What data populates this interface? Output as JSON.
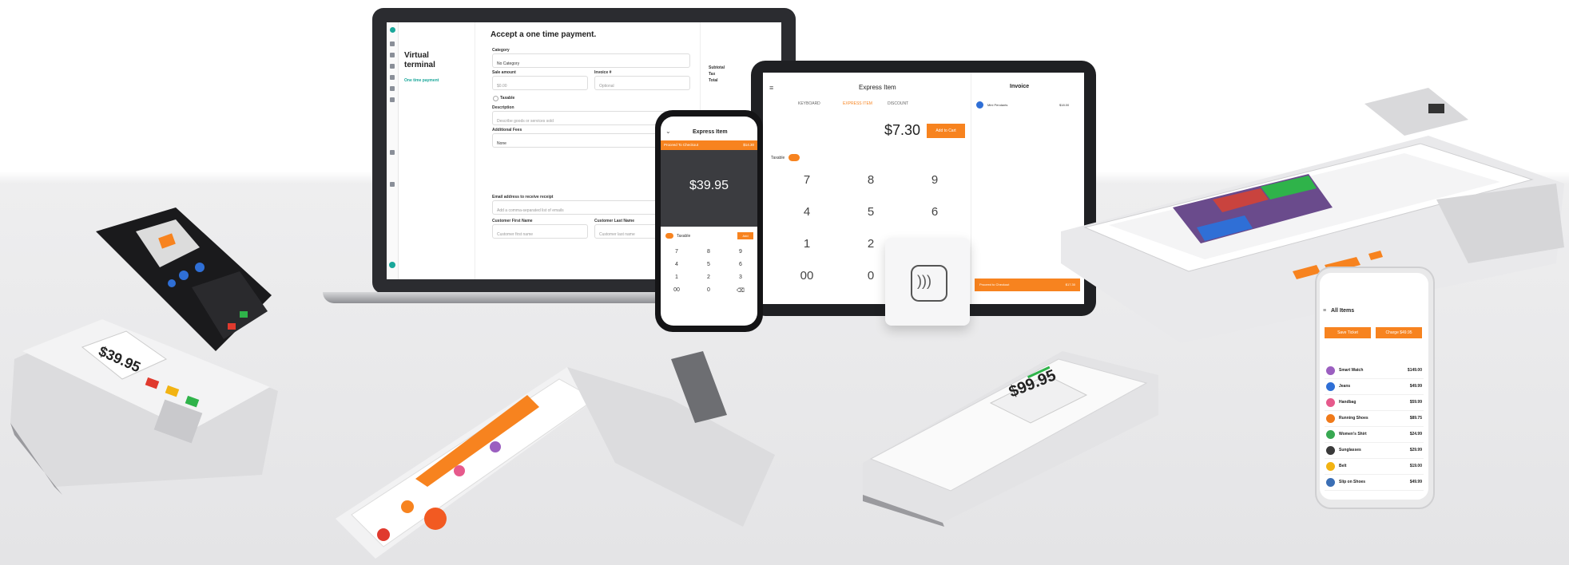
{
  "virtual_terminal": {
    "heading": "Accept a one time payment.",
    "title": "Virtual terminal",
    "nav_item": "One time payment",
    "category_label": "Category",
    "category_value": "No Category",
    "sale_amount_label": "Sale amount",
    "sale_amount_placeholder": "$0.00",
    "invoice_label": "Invoice #",
    "invoice_placeholder": "Optional",
    "taxable_label": "Taxable",
    "description_label": "Description",
    "description_placeholder": "Describe goods or services sold",
    "additional_fees_label": "Additional Fees",
    "additional_fees_value": "None",
    "email_label": "Email address to receive receipt",
    "email_placeholder": "Add a comma-separated list of emails",
    "first_name_label": "Customer First Name",
    "first_name_placeholder": "Customer first name",
    "last_name_label": "Customer Last Name",
    "last_name_placeholder": "Customer last name",
    "summary": [
      "Subtotal",
      "Tax",
      "Total"
    ]
  },
  "tablet": {
    "title": "Express Item",
    "tabs": [
      "KEYBOARD",
      "EXPRESS ITEM",
      "DISCOUNT"
    ],
    "amount": "$7.30",
    "add_button": "Add to Cart",
    "taxable_label": "Taxable",
    "keypad": [
      "7",
      "8",
      "9",
      "4",
      "5",
      "6",
      "1",
      "2",
      "3",
      "00",
      "0"
    ],
    "invoice_title": "Invoice",
    "invoice_item": "Mini Pendants",
    "invoice_price": "$18.00",
    "proceed_label": "Proceed to Checkout",
    "proceed_amount": "$17.30"
  },
  "phone": {
    "title": "Express Item",
    "checkout_label": "Proceed To Checkout",
    "checkout_amount": "$14.30",
    "amount": "$39.95",
    "taxable_label": "Taxable",
    "add_label": "Add",
    "keypad": [
      "7",
      "8",
      "9",
      "4",
      "5",
      "6",
      "1",
      "2",
      "3",
      "00",
      "0",
      "⌫"
    ]
  },
  "left_terminal": {
    "amount": "$39.95"
  },
  "front_terminal": {
    "amount": "$99.95"
  },
  "handheld": {
    "header": "All Items"
  },
  "right_phone": {
    "header": "All Items",
    "btn_left": "Save Ticket",
    "btn_right": "Charge $49.95",
    "items": [
      {
        "name": "Smart Watch",
        "price": "$149.00",
        "color": "#9b5fc0"
      },
      {
        "name": "Jeans",
        "price": "$49.99",
        "color": "#2f6fd6"
      },
      {
        "name": "Handbag",
        "price": "$59.99",
        "color": "#e65a8c"
      },
      {
        "name": "Running Shoes",
        "price": "$89.75",
        "color": "#f07a1a"
      },
      {
        "name": "Women's Shirt",
        "price": "$24.99",
        "color": "#38a852"
      },
      {
        "name": "Sunglasses",
        "price": "$29.99",
        "color": "#3a3a3a"
      },
      {
        "name": "Belt",
        "price": "$19.00",
        "color": "#f2b312"
      },
      {
        "name": "Slip on Shoes",
        "price": "$49.99",
        "color": "#3b6fb5"
      }
    ]
  },
  "colors": {
    "accent": "#f7831f",
    "teal": "#1aa79a"
  }
}
